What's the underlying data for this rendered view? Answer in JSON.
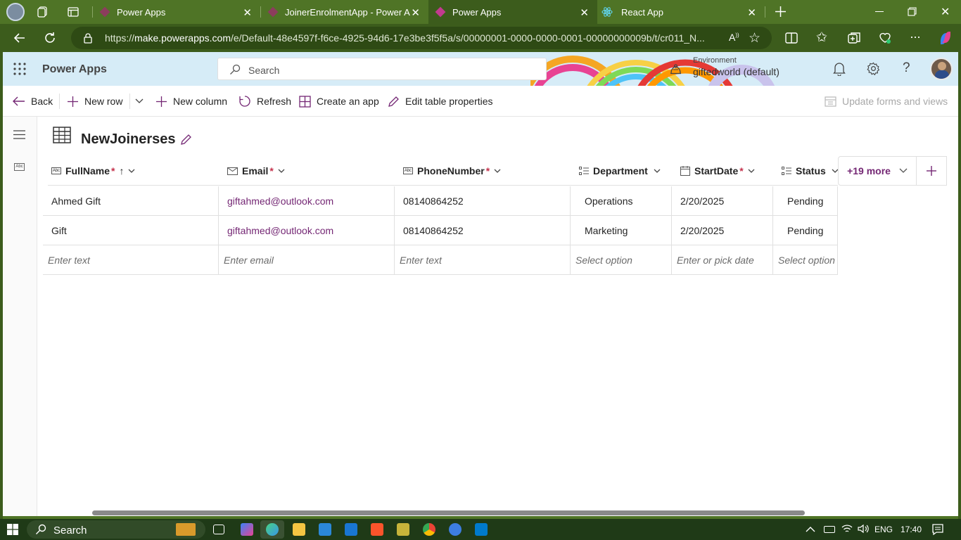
{
  "browser": {
    "tabs": [
      {
        "title": "Power Apps"
      },
      {
        "title": "JoinerEnrolmentApp - Power Apps"
      },
      {
        "title": "Power Apps"
      },
      {
        "title": "React App"
      }
    ],
    "url_prefix": "https://",
    "url_host": "make.powerapps.com",
    "url_path": "/e/Default-48e4597f-f6ce-4925-94d6-17e3be3f5f5a/s/00000001-0000-0000-0001-00000000009b/t/cr011_N..."
  },
  "header": {
    "app_title": "Power Apps",
    "search_placeholder": "Search",
    "environment_label": "Environment",
    "environment_value": "giftedworld (default)"
  },
  "commands": {
    "back": "Back",
    "new_row": "New row",
    "new_column": "New column",
    "refresh": "Refresh",
    "create_app": "Create an app",
    "edit_table": "Edit table properties",
    "update_forms": "Update forms and views"
  },
  "table": {
    "title": "NewJoinerses",
    "columns": [
      {
        "label": "FullName",
        "required": "*"
      },
      {
        "label": "Email",
        "required": "*"
      },
      {
        "label": "PhoneNumber",
        "required": "*"
      },
      {
        "label": "Department",
        "required": ""
      },
      {
        "label": "StartDate",
        "required": "*"
      },
      {
        "label": "Status",
        "required": ""
      }
    ],
    "more_columns": "+19 more",
    "rows": [
      [
        "Ahmed  Gift",
        "giftahmed@outlook.com",
        "08140864252",
        "Operations",
        "2/20/2025",
        "Pending"
      ],
      [
        "Gift",
        "giftahmed@outlook.com",
        "08140864252",
        "Marketing",
        "2/20/2025",
        "Pending"
      ]
    ],
    "new_row_placeholders": [
      "Enter text",
      "Enter email",
      "Enter text",
      "Select option",
      "Enter or pick date",
      "Select option"
    ]
  },
  "taskbar": {
    "search_placeholder": "Search",
    "language": "ENG",
    "time": "17:40"
  },
  "colors": {
    "browser_frame": "#4f7426",
    "accent_purple": "#742774",
    "header_bg": "#d6ecf7"
  }
}
